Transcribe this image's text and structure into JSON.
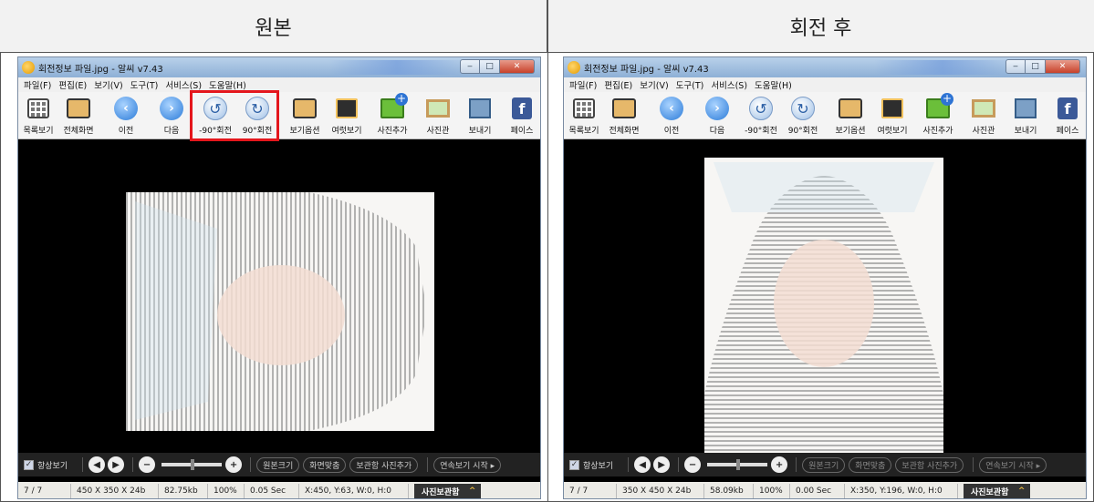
{
  "headers": {
    "left": "원본",
    "right": "회전 후"
  },
  "windows": [
    {
      "title": "회전정보 파일.jpg - 알씨 v7.43",
      "menu": [
        "파일(F)",
        "편집(E)",
        "보기(V)",
        "도구(T)",
        "서비스(S)",
        "도움말(H)"
      ],
      "toolbar": [
        "목록보기",
        "전체화면",
        "이전",
        "다음",
        "-90°회전",
        "90°회전",
        "보기옵션",
        "여럿보기",
        "사진추가",
        "사진관",
        "보내기",
        "페이스"
      ],
      "controls": {
        "always_view": "항상보기",
        "original_size": "원본크기",
        "fit_screen": "화면맞춤",
        "add_safe": "보관함 사진추가",
        "slideshow": "연속보기 시작 ▸"
      },
      "status": {
        "index": "7 / 7",
        "dims": "450 X 350 X 24b",
        "size": "82.75kb",
        "zoom": "100%",
        "time": "0.05 Sec",
        "pos": "X:450, Y:63, W:0, H:0",
        "safe": "사진보관함"
      }
    },
    {
      "title": "회전정보 파일.jpg - 알씨 v7.43",
      "menu": [
        "파일(F)",
        "편집(E)",
        "보기(V)",
        "도구(T)",
        "서비스(S)",
        "도움말(H)"
      ],
      "toolbar": [
        "목록보기",
        "전체화면",
        "이전",
        "다음",
        "-90°회전",
        "90°회전",
        "보기옵션",
        "여럿보기",
        "사진추가",
        "사진관",
        "보내기",
        "페이스"
      ],
      "controls": {
        "always_view": "항상보기",
        "original_size": "원본크기",
        "fit_screen": "화면맞춤",
        "add_safe": "보관함 사진추가",
        "slideshow": "연속보기 시작 ▸"
      },
      "status": {
        "index": "7 / 7",
        "dims": "350 X 450 X 24b",
        "size": "58.09kb",
        "zoom": "100%",
        "time": "0.00 Sec",
        "pos": "X:350, Y:196, W:0, H:0",
        "safe": "사진보관함"
      }
    }
  ],
  "highlight_color": "#e4161c"
}
